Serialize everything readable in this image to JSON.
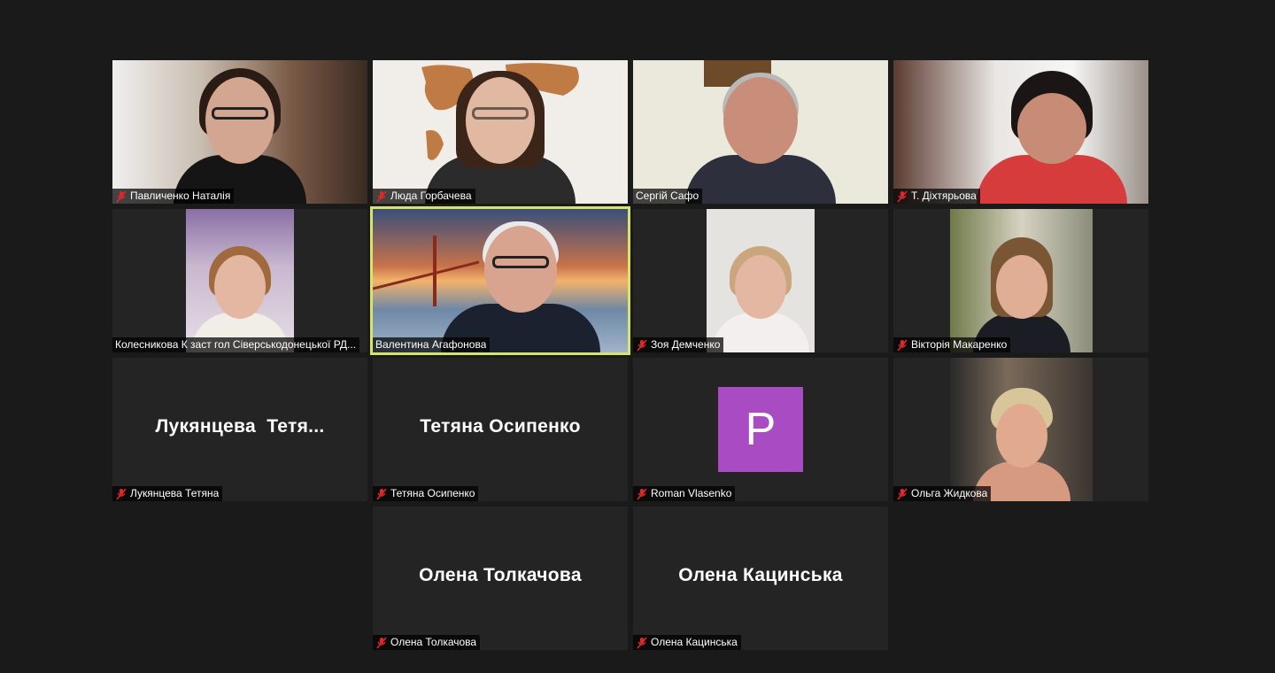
{
  "participants": [
    {
      "name": "Павличенко Наталія",
      "muted": true
    },
    {
      "name": "Люда Горбачева",
      "muted": true
    },
    {
      "name": "Сергій Сафо",
      "muted": false
    },
    {
      "name": "Т. Діхтярьова",
      "muted": true
    },
    {
      "name": "Колесникова К заст гол Сіверськодонецької РД...",
      "muted": false
    },
    {
      "name": "Валентина Агафонова",
      "muted": false,
      "active_speaker": true
    },
    {
      "name": "Зоя Демченко",
      "muted": true
    },
    {
      "name": "Вікторія Макаренко",
      "muted": true
    },
    {
      "name": "Лукянцева Тетяна",
      "muted": true,
      "display_name": "Лукянцева  Тетя..."
    },
    {
      "name": "Тетяна Осипенко",
      "muted": true,
      "display_name": "Тетяна Осипенко"
    },
    {
      "name": "Roman Vlasenko",
      "muted": true,
      "avatar_letter": "P"
    },
    {
      "name": "Ольга Жидкова",
      "muted": true
    },
    {
      "name": "Олена Толкачова",
      "muted": true,
      "display_name": "Олена Толкачова"
    },
    {
      "name": "Олена Кацинська",
      "muted": true,
      "display_name": "Олена Кацинська"
    }
  ],
  "colors": {
    "active_border": "#d8e36a",
    "avatar": "#a94cc4",
    "mic_muted": "#e02828"
  },
  "icons": {
    "muted": "mic-muted-icon"
  }
}
